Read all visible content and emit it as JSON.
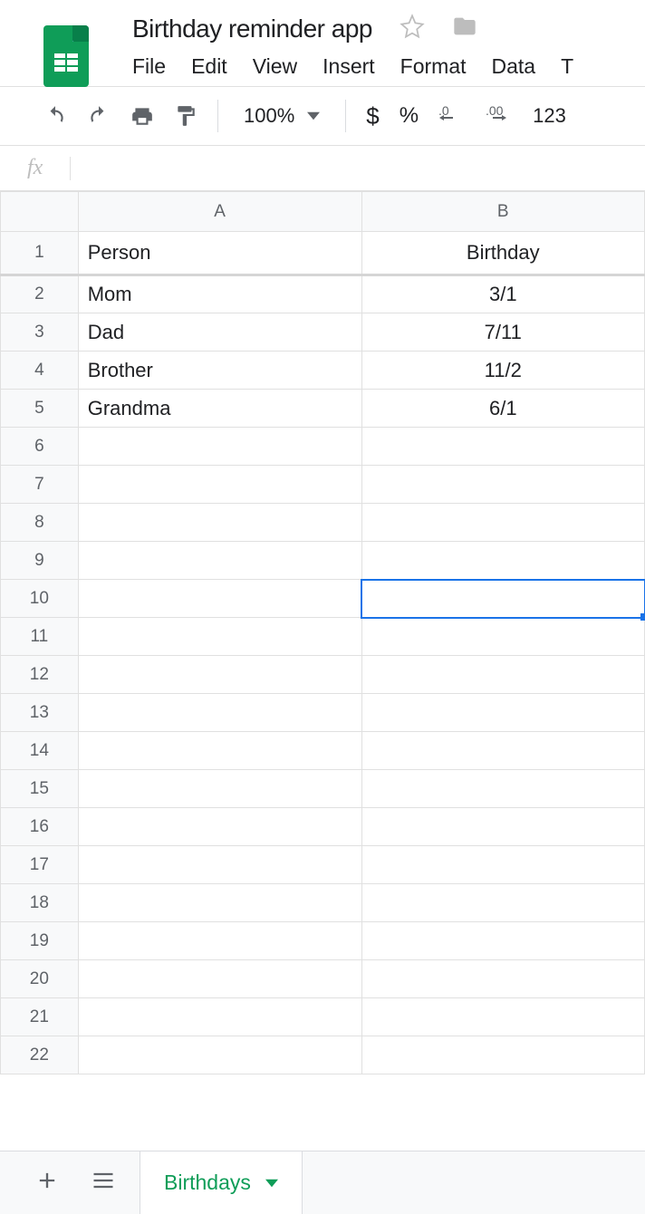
{
  "doc_title": "Birthday reminder app",
  "menubar": [
    "File",
    "Edit",
    "View",
    "Insert",
    "Format",
    "Data",
    "T"
  ],
  "toolbar": {
    "zoom": "100%",
    "fmt_auto": "123"
  },
  "formula": "",
  "columns": [
    "A",
    "B"
  ],
  "rows": [
    "1",
    "2",
    "3",
    "4",
    "5",
    "6",
    "7",
    "8",
    "9",
    "10",
    "11",
    "12",
    "13",
    "14",
    "15",
    "16",
    "17",
    "18",
    "19",
    "20",
    "21",
    "22"
  ],
  "cells": {
    "A1": "Person",
    "B1": "Birthday",
    "A2": "Mom",
    "B2": "3/1",
    "A3": "Dad",
    "B3": "7/11",
    "A4": "Brother",
    "B4": "11/2",
    "A5": "Grandma",
    "B5": "6/1"
  },
  "selected_cell": "B10",
  "sheet_tab": "Birthdays"
}
